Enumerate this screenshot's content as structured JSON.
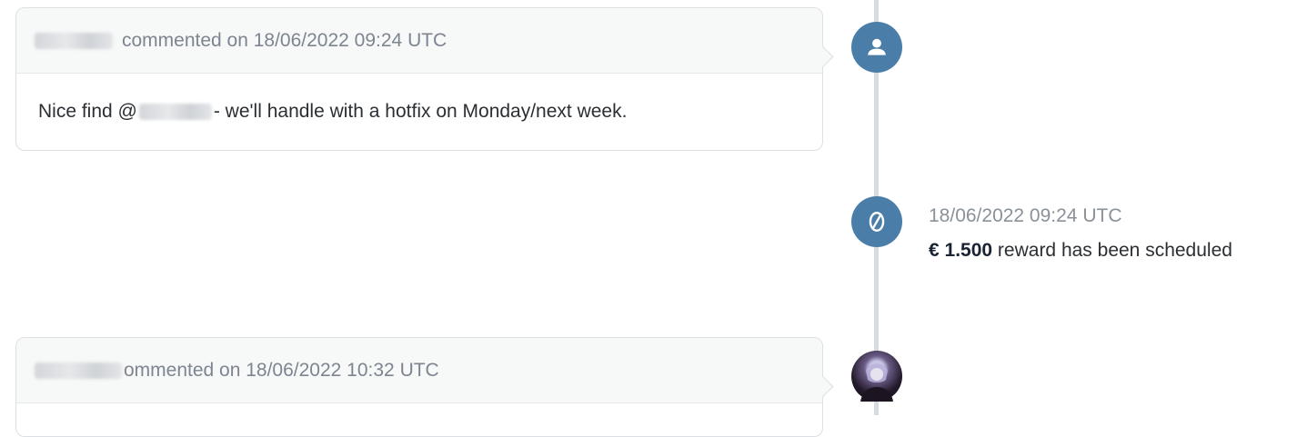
{
  "comments": [
    {
      "meta": "commented on 18/06/2022 09:24 UTC",
      "body_prefix": "Nice find @",
      "body_suffix": "- we'll handle with a hotfix on Monday/next week."
    },
    {
      "meta": "ommented on 18/06/2022 10:32 UTC"
    }
  ],
  "event": {
    "timestamp": "18/06/2022 09:24 UTC",
    "amount": "€ 1.500",
    "description": "reward has been scheduled"
  },
  "icons": {
    "comment1_node": "user-icon",
    "event_node": "reward-icon",
    "comment2_node": "avatar-image"
  },
  "colors": {
    "node_blue": "#4a7ea8",
    "timeline": "#d7dadf",
    "card_header": "#f7f8f8"
  }
}
